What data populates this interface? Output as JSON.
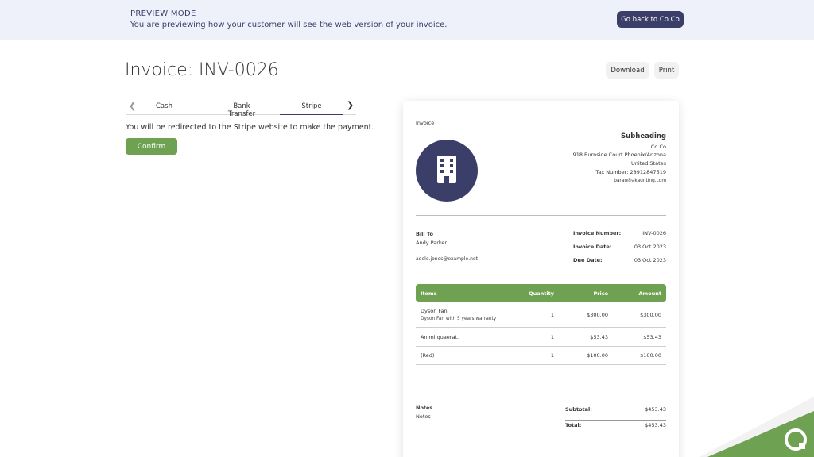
{
  "preview": {
    "title": "PREVIEW MODE",
    "text": "You are previewing how your customer will see the web version of your invoice.",
    "back_label": "Go back to Co Co"
  },
  "header": {
    "title": "Invoice: INV-0026",
    "download_label": "Download",
    "print_label": "Print"
  },
  "payment": {
    "tabs": [
      "Cash",
      "Bank Transfer",
      "Stripe"
    ],
    "active_tab": "Stripe",
    "redirect_text": "You will be redirected to the Stripe website to make the payment.",
    "confirm_label": "Confirm"
  },
  "invoice": {
    "label": "Invoice",
    "company": {
      "subheading": "Subheading",
      "name": "Co Co",
      "address": "918 Burnside Court Phoenix/Arizona",
      "country": "United States",
      "tax": "Tax Number: 28912847519",
      "email": "baran@akaunting.com"
    },
    "bill_to": {
      "heading": "Bill To",
      "name": "Andy Parker",
      "email": "adele.jones@example.net"
    },
    "meta": {
      "number_label": "Invoice Number:",
      "number": "INV-0026",
      "date_label": "Invoice Date:",
      "date": "03 Oct 2023",
      "due_label": "Due Date:",
      "due": "03 Oct 2023"
    },
    "columns": {
      "items": "Items",
      "quantity": "Quantity",
      "price": "Price",
      "amount": "Amount"
    },
    "rows": [
      {
        "name": "Dyson Fan",
        "desc": "Dyson Fan with 5 years warranty",
        "qty": "1",
        "price": "$300.00",
        "amount": "$300.00"
      },
      {
        "name": "Animi quaerat.",
        "desc": "",
        "qty": "1",
        "price": "$53.43",
        "amount": "$53.43"
      },
      {
        "name": "(Red)",
        "desc": "",
        "qty": "1",
        "price": "$100.00",
        "amount": "$100.00"
      }
    ],
    "notes": {
      "heading": "Notes",
      "text": "Notes"
    },
    "totals": {
      "subtotal_label": "Subtotal:",
      "subtotal": "$453.43",
      "total_label": "Total:",
      "total": "$453.43"
    }
  },
  "colors": {
    "accent": "#3b3e69",
    "green": "#6ea152",
    "preview_bg": "#eef0fa"
  }
}
